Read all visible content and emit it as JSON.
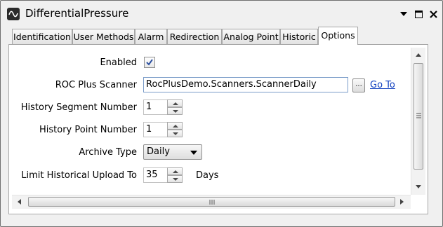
{
  "window": {
    "title": "DifferentialPressure",
    "icon": "waveform-icon",
    "controls": [
      "dropdown-icon",
      "maximize-icon",
      "close-icon"
    ]
  },
  "tabs": [
    {
      "label": "Identification",
      "active": false
    },
    {
      "label": "User Methods",
      "active": false
    },
    {
      "label": "Alarm",
      "active": false
    },
    {
      "label": "Redirection",
      "active": false
    },
    {
      "label": "Analog Point",
      "active": false
    },
    {
      "label": "Historic",
      "active": false
    },
    {
      "label": "Options",
      "active": true
    }
  ],
  "form": {
    "enabled": {
      "label": "Enabled",
      "checked": true
    },
    "scanner": {
      "label": "ROC Plus Scanner",
      "value": "RocPlusDemo.Scanners.ScannerDaily",
      "browse_label": "...",
      "goto_label": "Go To"
    },
    "segment": {
      "label": "History Segment Number",
      "value": "1"
    },
    "point": {
      "label": "History Point Number",
      "value": "1"
    },
    "archive": {
      "label": "Archive Type",
      "value": "Daily"
    },
    "limit": {
      "label": "Limit Historical Upload To",
      "value": "35",
      "units": "Days"
    }
  },
  "colors": {
    "link": "#0f3fbf",
    "checkmark": "#2b4f9e",
    "field_border": "#7a9cc9"
  }
}
